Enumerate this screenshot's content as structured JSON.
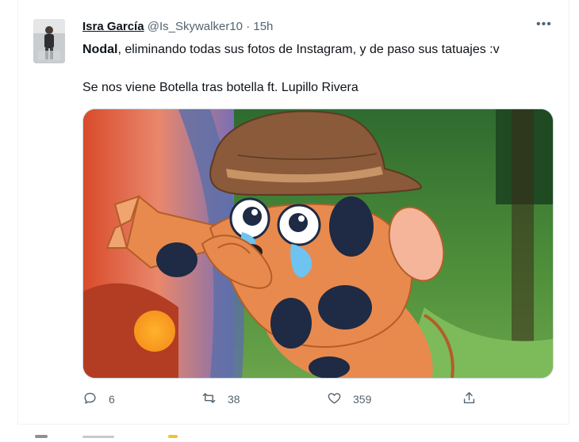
{
  "tweet": {
    "display_name": "Isra García",
    "handle": "@Is_Skywalker10",
    "dot": "·",
    "time": "15h",
    "more_icon": "more-horizontal-icon",
    "text_bold": "Nodal",
    "text_rest": ", eliminando todas sus fotos de Instagram, y de paso sus tatuajes :v",
    "text_line2": "Se nos viene Botella tras botella ft. Lupillo Rivera"
  },
  "actions": {
    "reply_count": "6",
    "retweet_count": "38",
    "like_count": "359",
    "reply_icon": "reply-icon",
    "retweet_icon": "retweet-icon",
    "like_icon": "heart-icon",
    "share_icon": "share-icon"
  },
  "colors": {
    "text": "#0f1419",
    "secondary": "#536471",
    "border": "#cfd9de"
  }
}
